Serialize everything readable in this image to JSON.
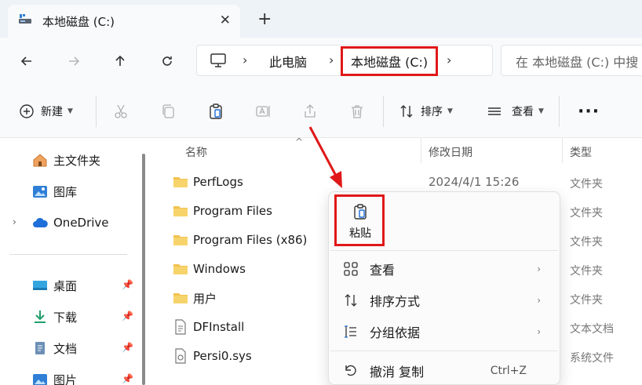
{
  "tab": {
    "title": "本地磁盘 (C:)",
    "close": "✕",
    "new": "+"
  },
  "address": {
    "crumbs": [
      "此电脑",
      "本地磁盘 (C:)"
    ],
    "search_placeholder": "在 本地磁盘 (C:) 中搜"
  },
  "toolbar": {
    "new_label": "新建",
    "sort_label": "排序",
    "view_label": "查看",
    "more": "···"
  },
  "sidebar": {
    "items": [
      {
        "label": "主文件夹"
      },
      {
        "label": "图库"
      },
      {
        "label": "OneDrive"
      },
      {
        "label": "桌面"
      },
      {
        "label": "下载"
      },
      {
        "label": "文档"
      },
      {
        "label": "图片"
      }
    ]
  },
  "columns": {
    "name": "名称",
    "date": "修改日期",
    "type": "类型"
  },
  "files": [
    {
      "name": "PerfLogs",
      "date": "2024/4/1 15:26",
      "type": "文件夹"
    },
    {
      "name": "Program Files",
      "date": "",
      "type": "文件夹"
    },
    {
      "name": "Program Files (x86)",
      "date": "",
      "type": "文件夹"
    },
    {
      "name": "Windows",
      "date": "",
      "type": "文件夹"
    },
    {
      "name": "用户",
      "date": "",
      "type": "文件夹"
    },
    {
      "name": "DFInstall",
      "date": "",
      "type": "文本文档"
    },
    {
      "name": "Persi0.sys",
      "date": "",
      "type": "系统文件"
    }
  ],
  "context_menu": {
    "paste": "粘贴",
    "items": [
      {
        "label": "查看"
      },
      {
        "label": "排序方式"
      },
      {
        "label": "分组依据"
      },
      {
        "label": "撤消 复制",
        "shortcut": "Ctrl+Z"
      }
    ]
  },
  "colors": {
    "highlight": "#e01818",
    "folder": "#f2c14e",
    "accent": "#1e6fd9"
  }
}
